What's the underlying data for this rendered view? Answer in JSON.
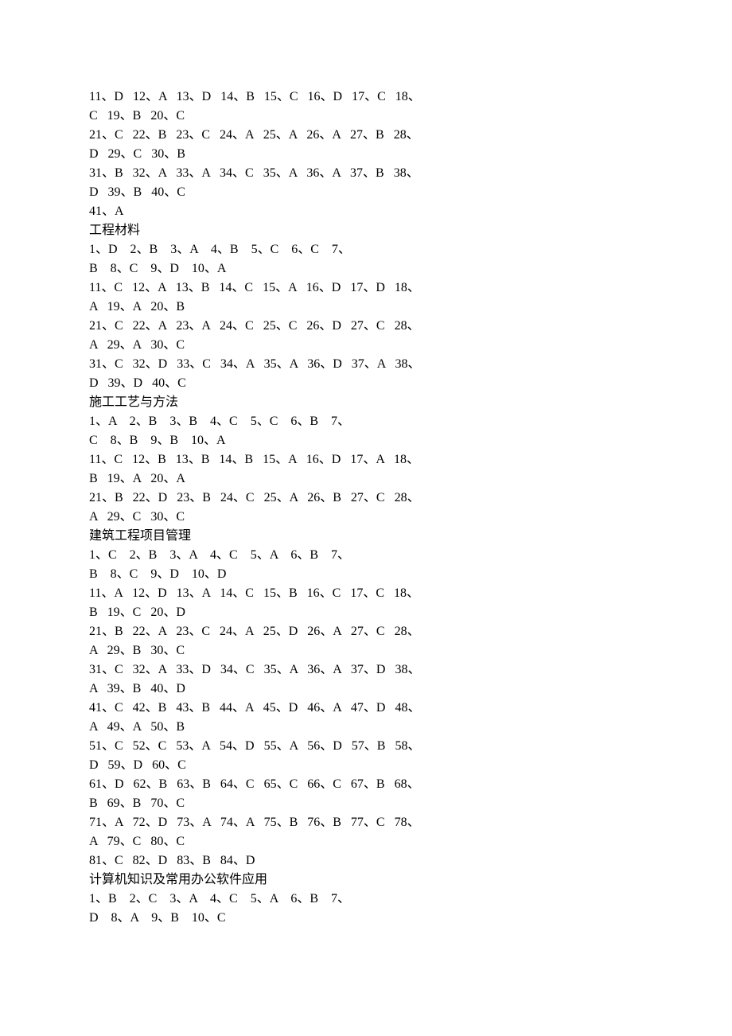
{
  "sections": [
    {
      "title": null,
      "groups": [
        {
          "range": [
            11,
            20
          ],
          "answers": [
            "D",
            "A",
            "D",
            "B",
            "C",
            "D",
            "C",
            "C",
            "B",
            "C"
          ],
          "style": "normal"
        },
        {
          "range": [
            21,
            30
          ],
          "answers": [
            "C",
            "B",
            "C",
            "A",
            "A",
            "A",
            "B",
            "D",
            "C",
            "B"
          ],
          "style": "normal"
        },
        {
          "range": [
            31,
            40
          ],
          "answers": [
            "B",
            "A",
            "A",
            "C",
            "A",
            "A",
            "B",
            "D",
            "B",
            "C"
          ],
          "style": "normal"
        },
        {
          "range": [
            41,
            41
          ],
          "answers": [
            "A"
          ],
          "style": "normal"
        }
      ]
    },
    {
      "title": "工程材料",
      "groups": [
        {
          "range": [
            1,
            10
          ],
          "answers": [
            "D",
            "B",
            "A",
            "B",
            "C",
            "C",
            "B",
            "C",
            "D",
            "A"
          ],
          "style": "wide"
        },
        {
          "range": [
            11,
            20
          ],
          "answers": [
            "C",
            "A",
            "B",
            "C",
            "A",
            "D",
            "D",
            "A",
            "A",
            "B"
          ],
          "style": "normal"
        },
        {
          "range": [
            21,
            30
          ],
          "answers": [
            "C",
            "A",
            "A",
            "C",
            "C",
            "D",
            "C",
            "A",
            "A",
            "C"
          ],
          "style": "normal"
        },
        {
          "range": [
            31,
            40
          ],
          "answers": [
            "C",
            "D",
            "C",
            "A",
            "A",
            "D",
            "A",
            "D",
            "D",
            "C"
          ],
          "style": "normal"
        }
      ]
    },
    {
      "title": "施工工艺与方法",
      "groups": [
        {
          "range": [
            1,
            10
          ],
          "answers": [
            "A",
            "B",
            "B",
            "C",
            "C",
            "B",
            "C",
            "B",
            "B",
            "A"
          ],
          "style": "wide"
        },
        {
          "range": [
            11,
            20
          ],
          "answers": [
            "C",
            "B",
            "B",
            "B",
            "A",
            "D",
            "A",
            "B",
            "A",
            "A"
          ],
          "style": "normal"
        },
        {
          "range": [
            21,
            30
          ],
          "answers": [
            "B",
            "D",
            "B",
            "C",
            "A",
            "B",
            "C",
            "A",
            "C",
            "C"
          ],
          "style": "normal"
        }
      ]
    },
    {
      "title": "建筑工程项目管理",
      "groups": [
        {
          "range": [
            1,
            10
          ],
          "answers": [
            "C",
            "B",
            "A",
            "C",
            "A",
            "B",
            "B",
            "C",
            "D",
            "D"
          ],
          "style": "wide"
        },
        {
          "range": [
            11,
            20
          ],
          "answers": [
            "A",
            "D",
            "A",
            "C",
            "B",
            "C",
            "C",
            "B",
            "C",
            "D"
          ],
          "style": "normal"
        },
        {
          "range": [
            21,
            30
          ],
          "answers": [
            "B",
            "A",
            "C",
            "A",
            "D",
            "A",
            "C",
            "A",
            "B",
            "C"
          ],
          "style": "normal"
        },
        {
          "range": [
            31,
            40
          ],
          "answers": [
            "C",
            "A",
            "D",
            "C",
            "A",
            "A",
            "D",
            "A",
            "B",
            "D"
          ],
          "style": "normal"
        },
        {
          "range": [
            41,
            50
          ],
          "answers": [
            "C",
            "B",
            "B",
            "A",
            "D",
            "A",
            "D",
            "A",
            "A",
            "B"
          ],
          "style": "normal"
        },
        {
          "range": [
            51,
            60
          ],
          "answers": [
            "C",
            "C",
            "A",
            "D",
            "A",
            "D",
            "B",
            "D",
            "D",
            "C"
          ],
          "style": "normal"
        },
        {
          "range": [
            61,
            70
          ],
          "answers": [
            "D",
            "B",
            "B",
            "C",
            "C",
            "C",
            "B",
            "B",
            "B",
            "C"
          ],
          "style": "normal"
        },
        {
          "range": [
            71,
            80
          ],
          "answers": [
            "A",
            "D",
            "A",
            "A",
            "B",
            "B",
            "C",
            "A",
            "C",
            "C"
          ],
          "style": "normal"
        },
        {
          "range": [
            81,
            84
          ],
          "answers": [
            "C",
            "D",
            "B",
            "D"
          ],
          "style": "normal"
        }
      ]
    },
    {
      "title": "计算机知识及常用办公软件应用",
      "groups": [
        {
          "range": [
            1,
            10
          ],
          "answers": [
            "B",
            "C",
            "A",
            "C",
            "A",
            "B",
            "D",
            "A",
            "B",
            "C"
          ],
          "style": "wide"
        }
      ]
    }
  ]
}
